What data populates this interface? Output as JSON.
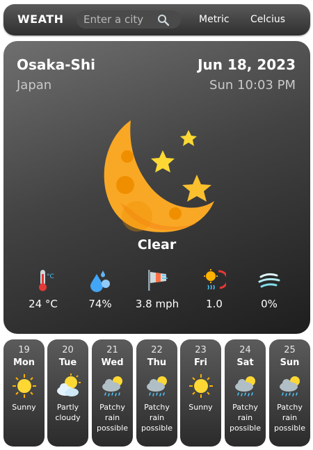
{
  "header": {
    "brand": "WEATH",
    "search_placeholder": "Enter a city",
    "unit_system": "Metric",
    "temp_unit": "Celcius"
  },
  "current": {
    "city": "Osaka-Shi",
    "country": "Japan",
    "date": "Jun 18, 2023",
    "time": "Sun 10:03 PM",
    "condition": "Clear",
    "icon": "moon-stars-icon",
    "metrics": [
      {
        "icon": "thermometer-icon",
        "value": "24 °C"
      },
      {
        "icon": "humidity-drops-icon",
        "value": "74%"
      },
      {
        "icon": "wind-icon",
        "value": "3.8 mph"
      },
      {
        "icon": "uv-index-icon",
        "value": "1.0"
      },
      {
        "icon": "rain-chance-icon",
        "value": "0%"
      }
    ]
  },
  "forecast": [
    {
      "day_num": "19",
      "day_name": "Mon",
      "condition": "Sunny",
      "icon": "sun-icon"
    },
    {
      "day_num": "20",
      "day_name": "Tue",
      "condition": "Partly cloudy",
      "icon": "partly-cloudy-icon"
    },
    {
      "day_num": "21",
      "day_name": "Wed",
      "condition": "Patchy rain possible",
      "icon": "patchy-rain-icon"
    },
    {
      "day_num": "22",
      "day_name": "Thu",
      "condition": "Patchy rain possible",
      "icon": "patchy-rain-icon"
    },
    {
      "day_num": "23",
      "day_name": "Fri",
      "condition": "Sunny",
      "icon": "sun-icon"
    },
    {
      "day_num": "24",
      "day_name": "Sat",
      "condition": "Patchy rain possible",
      "icon": "patchy-rain-icon"
    },
    {
      "day_num": "25",
      "day_name": "Sun",
      "condition": "Patchy rain possible",
      "icon": "patchy-rain-icon"
    }
  ],
  "colors": {
    "moon": "#f9a825",
    "star": "#fdd835",
    "card_dark": "#1e1e1e"
  }
}
